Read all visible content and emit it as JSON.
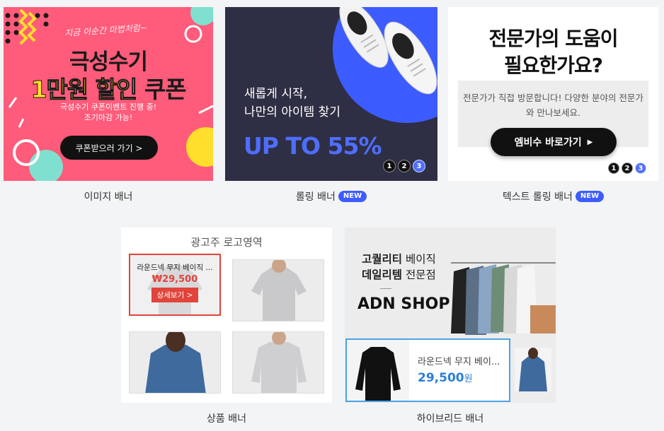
{
  "banners": [
    {
      "caption": "이미지 배너",
      "tagline": "지금 이순간 마법처럼~",
      "title_line1": "극성수기",
      "title_highlight": "1만원 할인",
      "title_suffix": "쿠폰",
      "sub1": "극성수기 쿠폰이벤트 진행 중!",
      "sub2": "조기마감 가능!",
      "button": "쿠폰받으러 가기 >"
    },
    {
      "caption": "롤링 배너",
      "badge": "NEW",
      "line1": "새롭게 시작,",
      "line2": "나만의 아이템 찾기",
      "promo": "UP TO 55%",
      "dots": [
        "1",
        "2",
        "3"
      ]
    },
    {
      "caption": "텍스트 롤링 배너",
      "badge": "NEW",
      "head1": "전문가의 도움이",
      "head2": "필요한가요?",
      "desc": "전문가가 직접 방문합니다! 다양한 분야의 전문가와 만나보세요.",
      "button": "엠비수 바로가기",
      "dots": [
        "1",
        "2",
        "3"
      ]
    },
    {
      "caption": "상품 배너",
      "logo_area": "광고주 로고영역",
      "product_name": "라운드넥 무지 베이직 ...",
      "product_price": "₩29,500",
      "detail_button": "상세보기 >"
    },
    {
      "caption": "하이브리드 배너",
      "headline1_bold": "고퀄리티",
      "headline1_light": " 베이직",
      "headline2_bold": "데일리템",
      "headline2_light": " 전문점",
      "shop": "ADN SHOP",
      "product_name": "라운드넥 무지 베이...",
      "product_price": "29,500",
      "price_unit": "원"
    }
  ],
  "colors": {
    "pink": "#ff5b7a",
    "navy": "#2e2f44",
    "blue_accent": "#3d5cff",
    "red_accent": "#e0443b",
    "sky": "#4da3e6"
  }
}
